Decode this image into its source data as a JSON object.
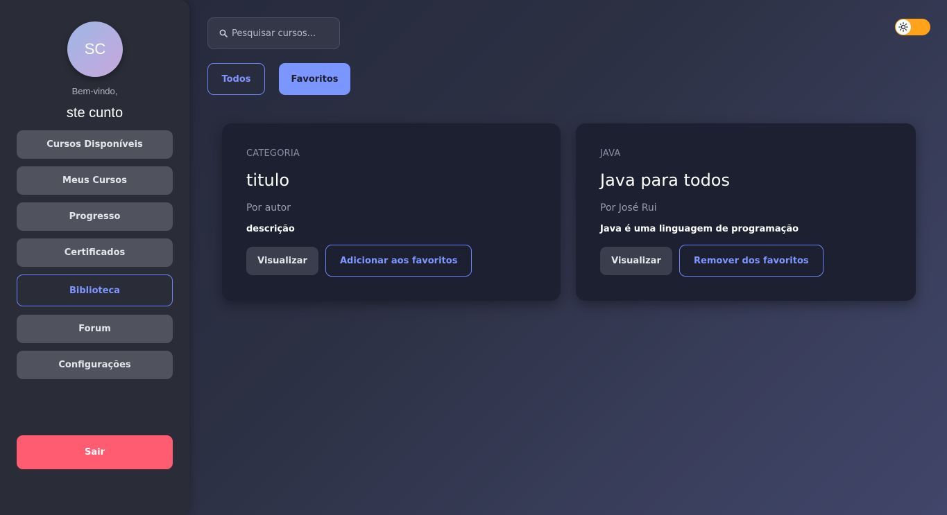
{
  "sidebar": {
    "avatar_initials": "SC",
    "welcome": "Bem-vindo,",
    "username": "ste cunto",
    "items": [
      {
        "label": "Cursos Disponíveis"
      },
      {
        "label": "Meus Cursos"
      },
      {
        "label": "Progresso"
      },
      {
        "label": "Certificados"
      },
      {
        "label": "Biblioteca"
      },
      {
        "label": "Forum"
      },
      {
        "label": "Configurações"
      }
    ],
    "active_item": "Biblioteca",
    "logout_label": "Sair"
  },
  "search": {
    "placeholder": "Pesquisar cursos...",
    "icon": "search-icon"
  },
  "filters": {
    "all_label": "Todos",
    "favorites_label": "Favoritos",
    "selected": "Favoritos"
  },
  "theme_toggle": {
    "icon": "sun-icon",
    "state": "light"
  },
  "cards": [
    {
      "category": "CATEGORIA",
      "title": "titulo",
      "author": "Por autor",
      "description": "descrição",
      "view_label": "Visualizar",
      "favorite_label": "Adicionar aos favoritos"
    },
    {
      "category": "JAVA",
      "title": "Java para todos",
      "author": "Por José Rui",
      "description": "Java é uma linguagem de programação",
      "view_label": "Visualizar",
      "favorite_label": "Remover dos favoritos"
    }
  ],
  "colors": {
    "accent": "#7b96ff",
    "logout": "#ff5c72",
    "toggle": "#ffa31a",
    "sidebar_bg": "#2a2d38",
    "card_bg": "#1d2031"
  }
}
